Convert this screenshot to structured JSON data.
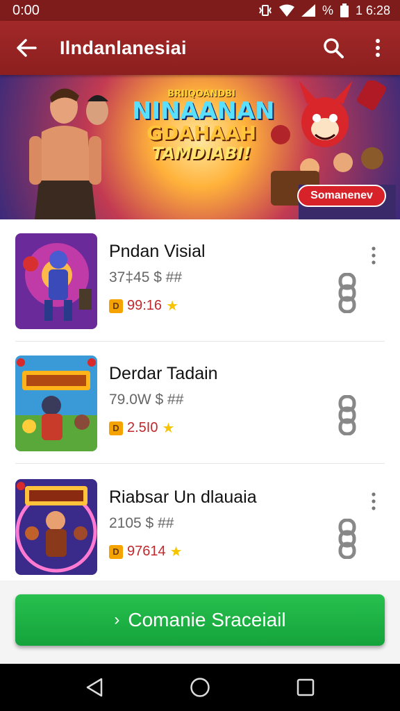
{
  "status_bar": {
    "time": "0:00",
    "battery_pct": "%",
    "clock": "1 6:28"
  },
  "app_bar": {
    "title": "Ilndanlanesiai",
    "icons": [
      "back-arrow-icon",
      "search-icon",
      "more-vert-icon"
    ]
  },
  "banner": {
    "logo_lines": [
      "BRIIQOANDBI",
      "NINAANAN",
      "GDAHAAH",
      "TAMDIABI!"
    ],
    "badge": "Somanenev"
  },
  "list": {
    "items": [
      {
        "name": "Pndan Visial",
        "meta": "37‡45 $ ##",
        "rating": "99:16",
        "coin": "D"
      },
      {
        "name": "Derdar Tadain",
        "meta": "79.0W $ ##",
        "rating": "2.5I0",
        "coin": "D"
      },
      {
        "name": "Riabsar Un dlauaia",
        "meta": "2105 $ ##",
        "rating": "97614",
        "coin": "D"
      }
    ]
  },
  "cta": {
    "chevron": "›",
    "label": "Comanie Sraceiail"
  },
  "colors": {
    "app_bar": "#9a2323",
    "cta": "#1db446",
    "rating": "#c0282c",
    "star": "#f6c400"
  }
}
